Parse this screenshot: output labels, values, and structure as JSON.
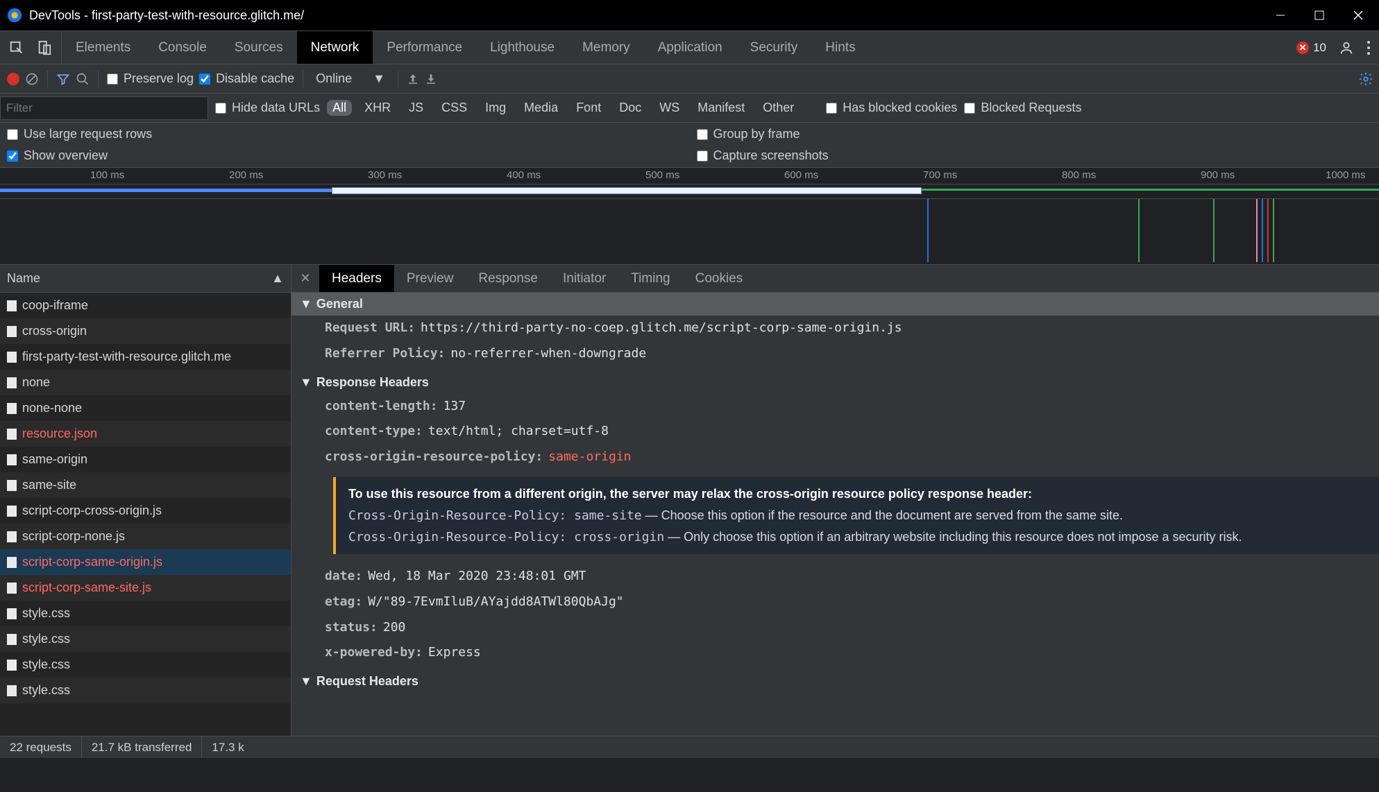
{
  "title": "DevTools - first-party-test-with-resource.glitch.me/",
  "errors_count": "10",
  "main_tabs": {
    "elements": "Elements",
    "console": "Console",
    "sources": "Sources",
    "network": "Network",
    "performance": "Performance",
    "lighthouse": "Lighthouse",
    "memory": "Memory",
    "application": "Application",
    "security": "Security",
    "hints": "Hints"
  },
  "toolbar": {
    "preserve_log": "Preserve log",
    "disable_cache": "Disable cache",
    "throttling": "Online"
  },
  "filter": {
    "placeholder": "Filter",
    "hide_data_urls": "Hide data URLs",
    "types": {
      "all": "All",
      "xhr": "XHR",
      "js": "JS",
      "css": "CSS",
      "img": "Img",
      "media": "Media",
      "font": "Font",
      "doc": "Doc",
      "ws": "WS",
      "manifest": "Manifest",
      "other": "Other"
    },
    "has_blocked_cookies": "Has blocked cookies",
    "blocked_requests": "Blocked Requests"
  },
  "options": {
    "use_large_rows": "Use large request rows",
    "show_overview": "Show overview",
    "group_by_frame": "Group by frame",
    "capture_screenshots": "Capture screenshots"
  },
  "timeline": {
    "ticks": [
      "100 ms",
      "200 ms",
      "300 ms",
      "400 ms",
      "500 ms",
      "600 ms",
      "700 ms",
      "800 ms",
      "900 ms",
      "1000 ms"
    ]
  },
  "name_col": "Name",
  "files": [
    {
      "name": "coop-iframe",
      "red": false
    },
    {
      "name": "cross-origin",
      "red": false
    },
    {
      "name": "first-party-test-with-resource.glitch.me",
      "red": false
    },
    {
      "name": "none",
      "red": false
    },
    {
      "name": "none-none",
      "red": false
    },
    {
      "name": "resource.json",
      "red": true
    },
    {
      "name": "same-origin",
      "red": false
    },
    {
      "name": "same-site",
      "red": false
    },
    {
      "name": "script-corp-cross-origin.js",
      "red": false
    },
    {
      "name": "script-corp-none.js",
      "red": false
    },
    {
      "name": "script-corp-same-origin.js",
      "red": true,
      "selected": true
    },
    {
      "name": "script-corp-same-site.js",
      "red": true
    },
    {
      "name": "style.css",
      "red": false
    },
    {
      "name": "style.css",
      "red": false
    },
    {
      "name": "style.css",
      "red": false
    },
    {
      "name": "style.css",
      "red": false
    }
  ],
  "detail_tabs": {
    "headers": "Headers",
    "preview": "Preview",
    "response": "Response",
    "initiator": "Initiator",
    "timing": "Timing",
    "cookies": "Cookies"
  },
  "sections": {
    "general": "General",
    "response_headers": "Response Headers",
    "request_headers": "Request Headers"
  },
  "general": {
    "request_url_k": "Request URL:",
    "request_url_v": "https://third-party-no-coep.glitch.me/script-corp-same-origin.js",
    "referrer_policy_k": "Referrer Policy:",
    "referrer_policy_v": "no-referrer-when-downgrade"
  },
  "resp": {
    "cl_k": "content-length:",
    "cl_v": "137",
    "ct_k": "content-type:",
    "ct_v": "text/html; charset=utf-8",
    "corp_k": "cross-origin-resource-policy:",
    "corp_v": "same-origin",
    "date_k": "date:",
    "date_v": "Wed, 18 Mar 2020 23:48:01 GMT",
    "etag_k": "etag:",
    "etag_v": "W/\"89-7EvmIluB/AYajdd8ATWl80QbAJg\"",
    "status_k": "status:",
    "status_v": "200",
    "xp_k": "x-powered-by:",
    "xp_v": "Express"
  },
  "info": {
    "heading": "To use this resource from a different origin, the server may relax the cross-origin resource policy response header:",
    "l1_code": "Cross-Origin-Resource-Policy: same-site",
    "l1_text": " — Choose this option if the resource and the document are served from the same site.",
    "l2_code": "Cross-Origin-Resource-Policy: cross-origin",
    "l2_text": " — Only choose this option if an arbitrary website including this resource does not impose a security risk."
  },
  "status": {
    "requests": "22 requests",
    "transferred": "21.7 kB transferred",
    "resources": "17.3 k"
  }
}
